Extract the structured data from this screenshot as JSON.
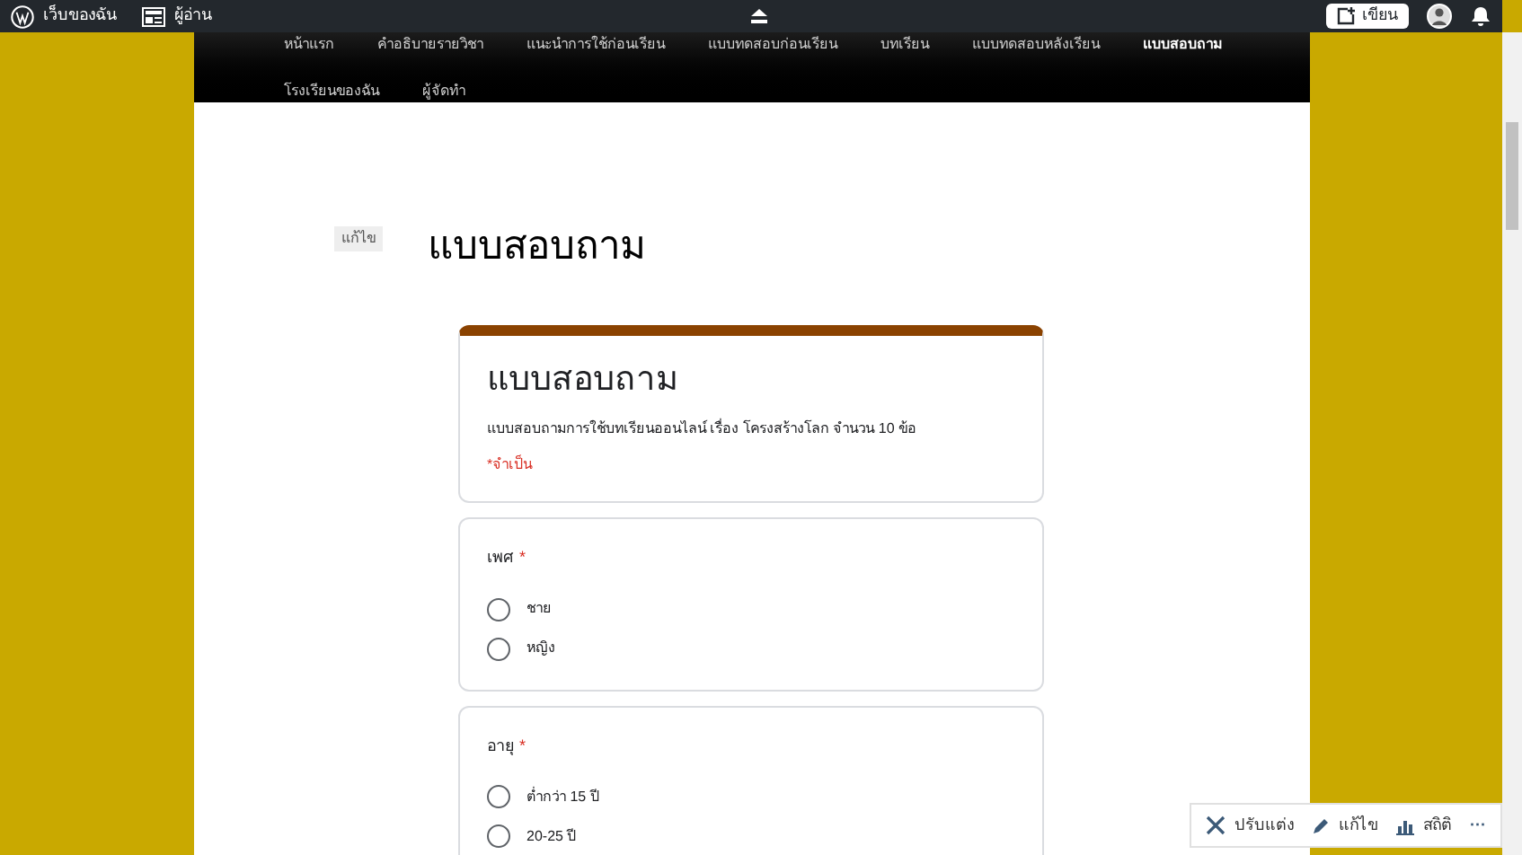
{
  "admin_bar": {
    "site": "เว็บของฉัน",
    "reader": "ผู้อ่าน",
    "write_button": "เขียน"
  },
  "nav": [
    {
      "label": "หน้าแรก",
      "selected": false
    },
    {
      "label": "คำอธิบายรายวิชา",
      "selected": false
    },
    {
      "label": "แนะนำการใช้ก่อนเรียน",
      "selected": false
    },
    {
      "label": "แบบทดสอบก่อนเรียน",
      "selected": false
    },
    {
      "label": "บทเรียน",
      "selected": false
    },
    {
      "label": "แบบทดสอบหลังเรียน",
      "selected": false
    },
    {
      "label": "แบบสอบถาม",
      "selected": true
    },
    {
      "label": "โรงเรียนของฉัน",
      "selected": false
    },
    {
      "label": "ผู้จัดทำ",
      "selected": false
    }
  ],
  "page": {
    "edit_label": "แก้ไข",
    "title": "แบบสอบถาม"
  },
  "form": {
    "title": "แบบสอบถาม",
    "description": "แบบสอบถามการใช้บทเรียนออนไลน์ เรื่อง โครงสร้างโลก จำนวน 10 ข้อ",
    "required_note": "*จำเป็น",
    "questions": [
      {
        "label": "เพศ",
        "required_mark": "*",
        "options": [
          {
            "label": "ชาย",
            "selected": false
          },
          {
            "label": "หญิง",
            "selected": false
          }
        ]
      },
      {
        "label": "อายุ",
        "required_mark": "*",
        "options": [
          {
            "label": "ต่ำกว่า 15 ปี",
            "selected": false
          },
          {
            "label": "20-25 ปี",
            "selected": false
          }
        ]
      }
    ]
  },
  "floating_toolbar": [
    {
      "kind": "customize",
      "label": "ปรับแต่ง"
    },
    {
      "kind": "edit",
      "label": "แก้ไข"
    },
    {
      "kind": "stats",
      "label": "สถิติ"
    },
    {
      "kind": "more",
      "label": "···"
    }
  ]
}
